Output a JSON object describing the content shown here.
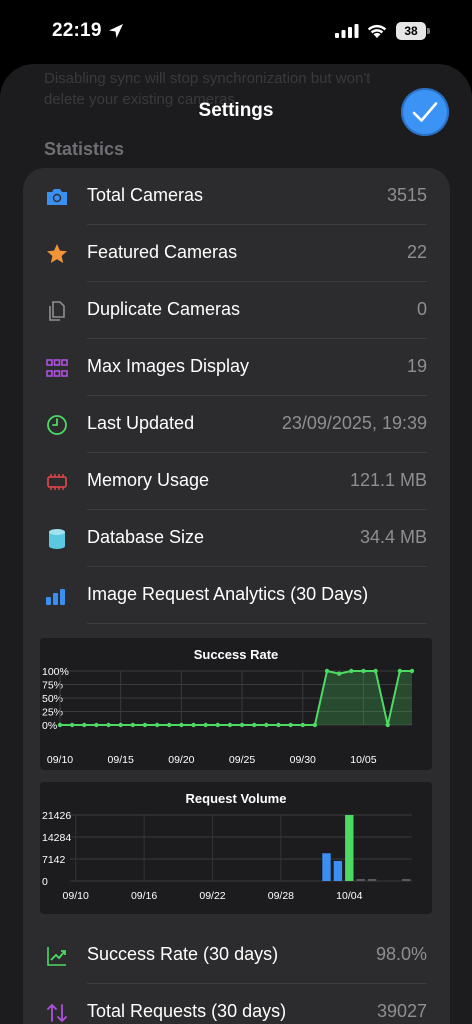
{
  "status_bar": {
    "time": "22:19",
    "battery": "38"
  },
  "sheet": {
    "ghost_text": "Disabling sync will stop synchronization but won't delete your existing cameras.",
    "title": "Settings",
    "section": "Statistics"
  },
  "stats": [
    {
      "icon": "camera-icon",
      "label": "Total Cameras",
      "value": "3515",
      "color": "#3a8ff0"
    },
    {
      "icon": "star-icon",
      "label": "Featured Cameras",
      "value": "22",
      "color": "#f0953a"
    },
    {
      "icon": "duplicate-icon",
      "label": "Duplicate Cameras",
      "value": "0",
      "color": "#8e8e93"
    },
    {
      "icon": "grid-icon",
      "label": "Max Images Display",
      "value": "19",
      "color": "#b04fe0"
    },
    {
      "icon": "clock-icon",
      "label": "Last Updated",
      "value": "23/09/2025, 19:39",
      "color": "#4cd964"
    },
    {
      "icon": "memory-icon",
      "label": "Memory Usage",
      "value": "121.1 MB",
      "color": "#e5484d"
    },
    {
      "icon": "database-icon",
      "label": "Database Size",
      "value": "34.4 MB",
      "color": "#5ac8e0"
    },
    {
      "icon": "bar-chart-icon",
      "label": "Image Request Analytics (30 Days)",
      "value": "",
      "color": "#3a8ff0"
    }
  ],
  "summary": [
    {
      "icon": "trend-icon",
      "label": "Success Rate (30 days)",
      "value": "98.0%",
      "color": "#4cd964"
    },
    {
      "icon": "arrows-icon",
      "label": "Total Requests (30 days)",
      "value": "39027",
      "color": "#b04fe0"
    }
  ],
  "chart_data": [
    {
      "type": "area",
      "title": "Success Rate",
      "y_ticks": [
        "100%",
        "75%",
        "50%",
        "25%",
        "0%"
      ],
      "x_ticks": [
        "09/10",
        "09/15",
        "09/20",
        "09/25",
        "09/30",
        "10/05"
      ],
      "ylim": [
        0,
        100
      ],
      "x": [
        "09/10",
        "09/11",
        "09/12",
        "09/13",
        "09/14",
        "09/15",
        "09/16",
        "09/17",
        "09/18",
        "09/19",
        "09/20",
        "09/21",
        "09/22",
        "09/23",
        "09/24",
        "09/25",
        "09/26",
        "09/27",
        "09/28",
        "09/29",
        "09/30",
        "10/01",
        "10/02",
        "10/03",
        "10/04",
        "10/05",
        "10/06",
        "10/07",
        "10/08",
        "10/09"
      ],
      "values": [
        0,
        0,
        0,
        0,
        0,
        0,
        0,
        0,
        0,
        0,
        0,
        0,
        0,
        0,
        0,
        0,
        0,
        0,
        0,
        0,
        0,
        0,
        100,
        95,
        100,
        100,
        100,
        0,
        100,
        100
      ],
      "color": "#4cd964",
      "grid": true
    },
    {
      "type": "bar",
      "title": "Request Volume",
      "y_ticks": [
        "21426",
        "14284",
        "7142",
        "0"
      ],
      "x_ticks": [
        "09/10",
        "09/16",
        "09/22",
        "09/28",
        "10/04"
      ],
      "ylim": [
        0,
        21426
      ],
      "x": [
        "09/10",
        "09/11",
        "09/12",
        "09/13",
        "09/14",
        "09/15",
        "09/16",
        "09/17",
        "09/18",
        "09/19",
        "09/20",
        "09/21",
        "09/22",
        "09/23",
        "09/24",
        "09/25",
        "09/26",
        "09/27",
        "09/28",
        "09/29",
        "09/30",
        "10/01",
        "10/02",
        "10/03",
        "10/04",
        "10/05",
        "10/06",
        "10/07",
        "10/08",
        "10/09"
      ],
      "values": [
        0,
        0,
        0,
        0,
        0,
        0,
        0,
        0,
        0,
        0,
        0,
        0,
        0,
        0,
        0,
        0,
        0,
        0,
        0,
        0,
        0,
        0,
        9000,
        6500,
        21426,
        400,
        400,
        0,
        0,
        500
      ],
      "colors": {
        "default": "#3a8ff0",
        "peak": "#4cd964",
        "low": "#5a5a5e"
      },
      "grid": true
    }
  ]
}
